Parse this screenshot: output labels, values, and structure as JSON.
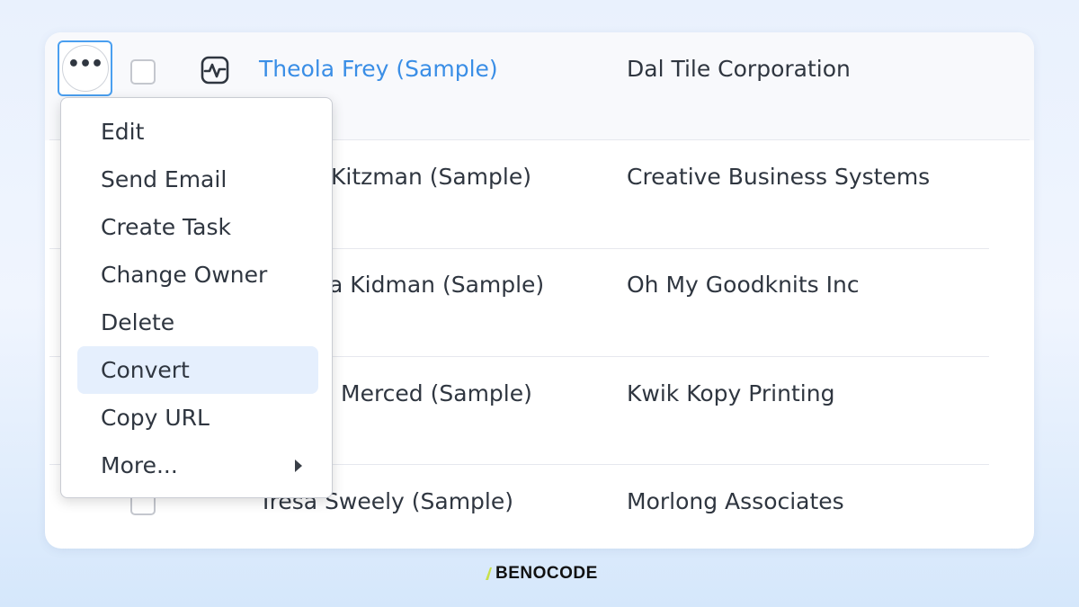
{
  "rows": [
    {
      "name": "Theola Frey (Sample)",
      "company": "Dal Tile Corporation"
    },
    {
      "name": "Kitzman (Sample)",
      "company": "Creative Business Systems"
    },
    {
      "name": "a Kidman (Sample)",
      "company": "Oh My Goodknits Inc"
    },
    {
      "name": "Merced (Sample)",
      "company": "Kwik Kopy Printing"
    },
    {
      "name": "Tresa Sweely (Sample)",
      "company": "Morlong Associates"
    }
  ],
  "row_action": {
    "more_icon": "ellipsis-icon",
    "activity_icon": "activity-pulse-icon"
  },
  "context_menu": {
    "items": [
      {
        "label": "Edit"
      },
      {
        "label": "Send Email"
      },
      {
        "label": "Create Task"
      },
      {
        "label": "Change Owner"
      },
      {
        "label": "Delete"
      },
      {
        "label": "Convert",
        "highlighted": true
      },
      {
        "label": "Copy URL"
      },
      {
        "label": "More...",
        "has_submenu": true
      }
    ]
  },
  "brand": {
    "logo_text": "BENOCODE"
  },
  "colors": {
    "link": "#3a8ee6",
    "focus_border": "#4a9ff0",
    "highlight": "#e5effd",
    "brand_accent": "#c8e04a"
  }
}
